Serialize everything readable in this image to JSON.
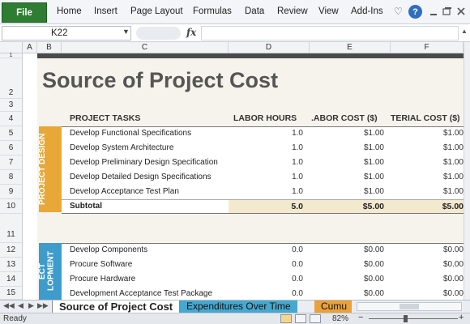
{
  "ribbon": {
    "file_label": "File",
    "tabs": [
      "Home",
      "Insert",
      "Page Layout",
      "Formulas",
      "Data",
      "Review",
      "View",
      "Add-Ins"
    ],
    "icons": [
      "heart-icon",
      "help-icon",
      "minimize-icon",
      "restore-icon",
      "close-icon"
    ],
    "help_glyph": "?"
  },
  "formula_bar": {
    "name_box": "K22",
    "fx_label": "fx",
    "formula": ""
  },
  "columns": [
    "A",
    "B",
    "C",
    "D",
    "E",
    "F"
  ],
  "rows": [
    "1",
    "2",
    "3",
    "4",
    "5",
    "6",
    "7",
    "8",
    "9",
    "10",
    "11",
    "12",
    "13",
    "14",
    "15"
  ],
  "sheet": {
    "title": "Source of Project Cost",
    "headers": {
      "tasks": "PROJECT TASKS",
      "labor_hours": "LABOR HOURS",
      "labor_cost": ".ABOR COST ($)",
      "material_cost": "TERIAL COST ($)"
    },
    "section1": {
      "label": "PROJECT DESIGN",
      "color": "#e8a838",
      "tasks": [
        {
          "name": "Develop Functional Specifications",
          "hours": "1.0",
          "labor": "$1.00",
          "material": "$1.00"
        },
        {
          "name": "Develop System Architecture",
          "hours": "1.0",
          "labor": "$1.00",
          "material": "$1.00"
        },
        {
          "name": "Develop Preliminary Design Specification",
          "hours": "1.0",
          "labor": "$1.00",
          "material": "$1.00"
        },
        {
          "name": "Develop Detailed Design Specifications",
          "hours": "1.0",
          "labor": "$1.00",
          "material": "$1.00"
        },
        {
          "name": "Develop Acceptance Test Plan",
          "hours": "1.0",
          "labor": "$1.00",
          "material": "$1.00"
        }
      ],
      "subtotal": {
        "label": "Subtotal",
        "hours": "5.0",
        "labor": "$5.00",
        "material": "$5.00"
      }
    },
    "section2": {
      "label": "ECT LOPMENT",
      "color": "#3d9ccb",
      "tasks": [
        {
          "name": "Develop Components",
          "hours": "0.0",
          "labor": "$0.00",
          "material": "$0.00"
        },
        {
          "name": "Procure Software",
          "hours": "0.0",
          "labor": "$0.00",
          "material": "$0.00"
        },
        {
          "name": "Procure Hardware",
          "hours": "0.0",
          "labor": "$0.00",
          "material": "$0.00"
        },
        {
          "name": "Development Acceptance Test Package",
          "hours": "0.0",
          "labor": "$0.00",
          "material": "$0.00"
        }
      ]
    }
  },
  "sheet_tabs": {
    "active": "Source of Project Cost",
    "second": "Expenditures Over Time",
    "third": "Cumu",
    "nav_glyphs": [
      "◀◀",
      "◀",
      "▶",
      "▶▶"
    ]
  },
  "status_bar": {
    "status": "Ready",
    "zoom": "82%",
    "zoom_minus": "−",
    "zoom_plus": "+"
  }
}
